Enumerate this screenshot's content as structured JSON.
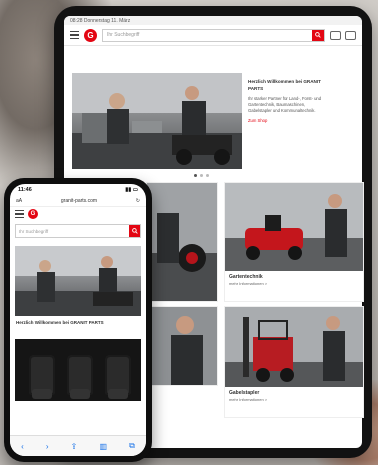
{
  "tablet": {
    "status_time": "08:28",
    "status_date": "Donnerstag 11. März",
    "search_placeholder": "Ihr Suchbegriff",
    "hero_heading": "Herzlich Willkommen bei GRANIT PARTS",
    "hero_text": "Ihr starker Partner für Land-, Forst- und Gartentechnik, Baumaschinen, Gabelstapler und Kommunaltechnik.",
    "hero_more": "Zum Shop",
    "tiles": [
      {
        "caption": "Gartentechnik",
        "sub": "mehr Informationen >"
      },
      {
        "caption": "Gabelstapler",
        "sub": "mehr Informationen >"
      }
    ]
  },
  "phone": {
    "status_time": "11:46",
    "url": "granit-parts.com",
    "search_placeholder": "Ihr Suchbegriff",
    "welcome": "Herzlich Willkommen bei GRANIT PARTS"
  },
  "logo_letter": "G",
  "colors": {
    "brand_red": "#e30613"
  }
}
